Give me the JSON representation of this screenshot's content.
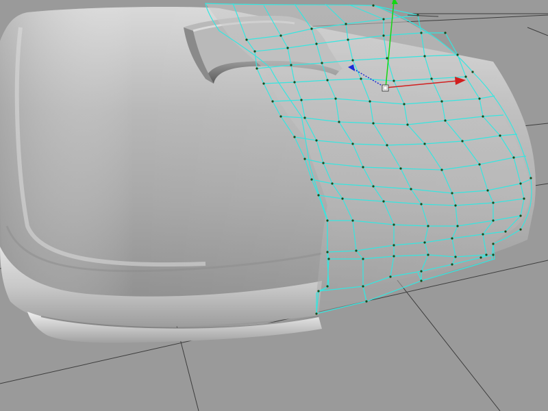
{
  "viewport": {
    "background_color": "#9a9a9a",
    "grid_color": "#3c3c3c",
    "model_color": "#c4c4c4",
    "wireframe_color": "#35e6e0",
    "vertex_color": "#1a4a1a"
  },
  "gizmo": {
    "x_axis_color": "#d21e1e",
    "y_axis_color": "#12d812",
    "z_axis_color": "#1a2bd8",
    "icons": [
      "move-gizmo-icon",
      "x-axis-arrow-icon",
      "y-axis-arrow-icon",
      "z-axis-arrow-icon"
    ]
  }
}
